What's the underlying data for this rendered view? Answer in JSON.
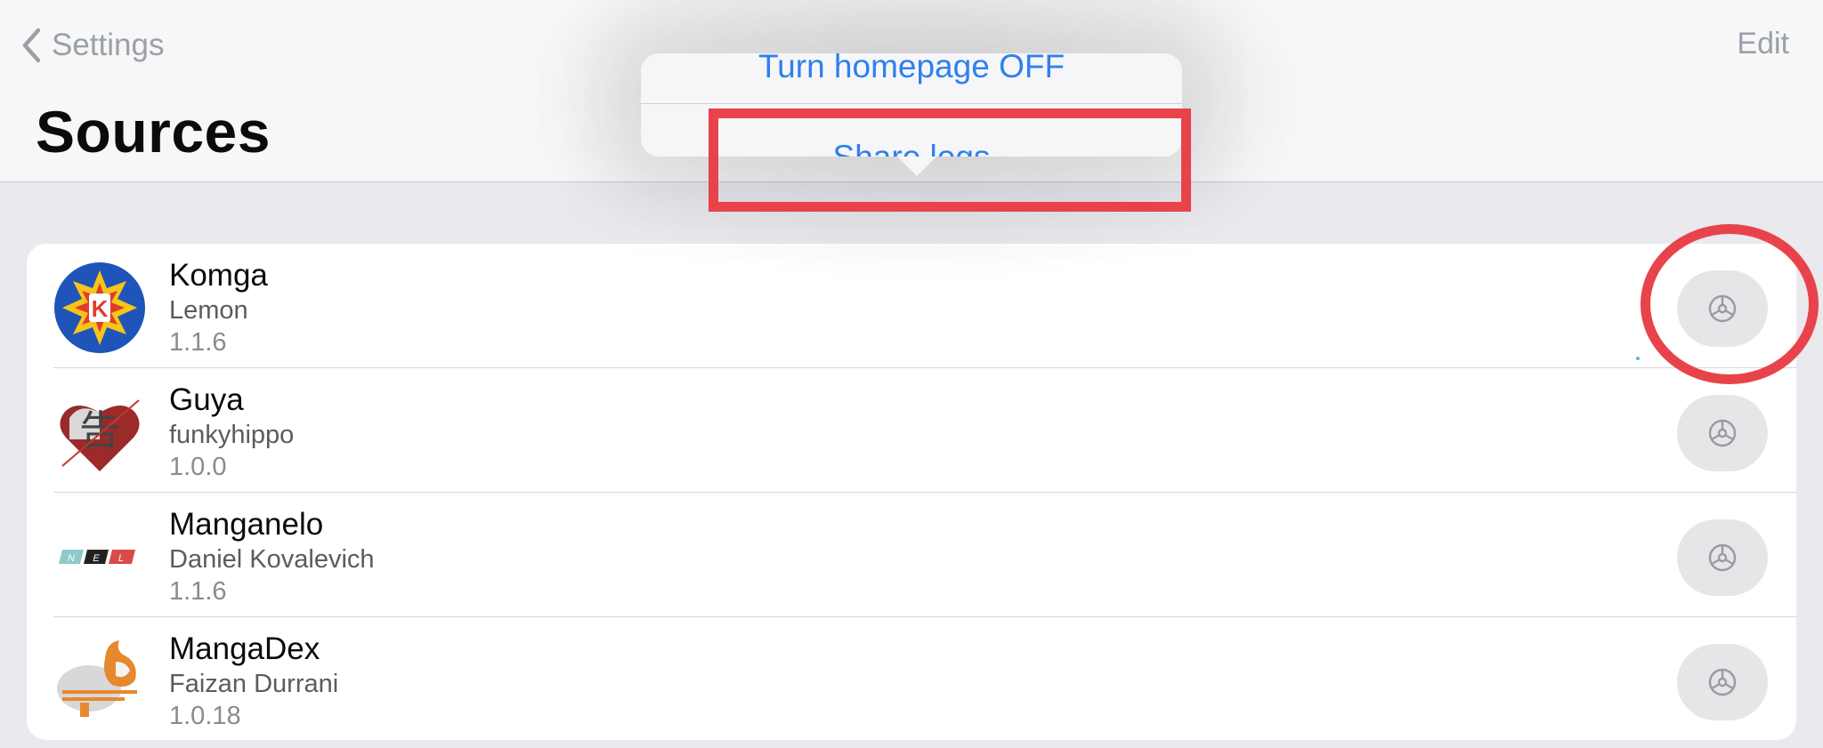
{
  "nav": {
    "back_label": "Settings",
    "edit_label": "Edit",
    "title": "Sources"
  },
  "popover": {
    "items": [
      {
        "label": "Turn homepage OFF"
      },
      {
        "label": "Share logs"
      }
    ]
  },
  "sources": [
    {
      "name": "Komga",
      "author": "Lemon",
      "version": "1.1.6",
      "icon": "komga-logo-icon"
    },
    {
      "name": "Guya",
      "author": "funkyhippo",
      "version": "1.0.0",
      "icon": "guya-logo-icon"
    },
    {
      "name": "Manganelo",
      "author": "Daniel Kovalevich",
      "version": "1.1.6",
      "icon": "manganelo-logo-icon"
    },
    {
      "name": "MangaDex",
      "author": "Faizan Durrani",
      "version": "1.0.18",
      "icon": "mangadex-logo-icon"
    }
  ],
  "colors": {
    "accent": "#2f80ed",
    "highlight": "#e8434b",
    "background": "#e9e9ee"
  }
}
